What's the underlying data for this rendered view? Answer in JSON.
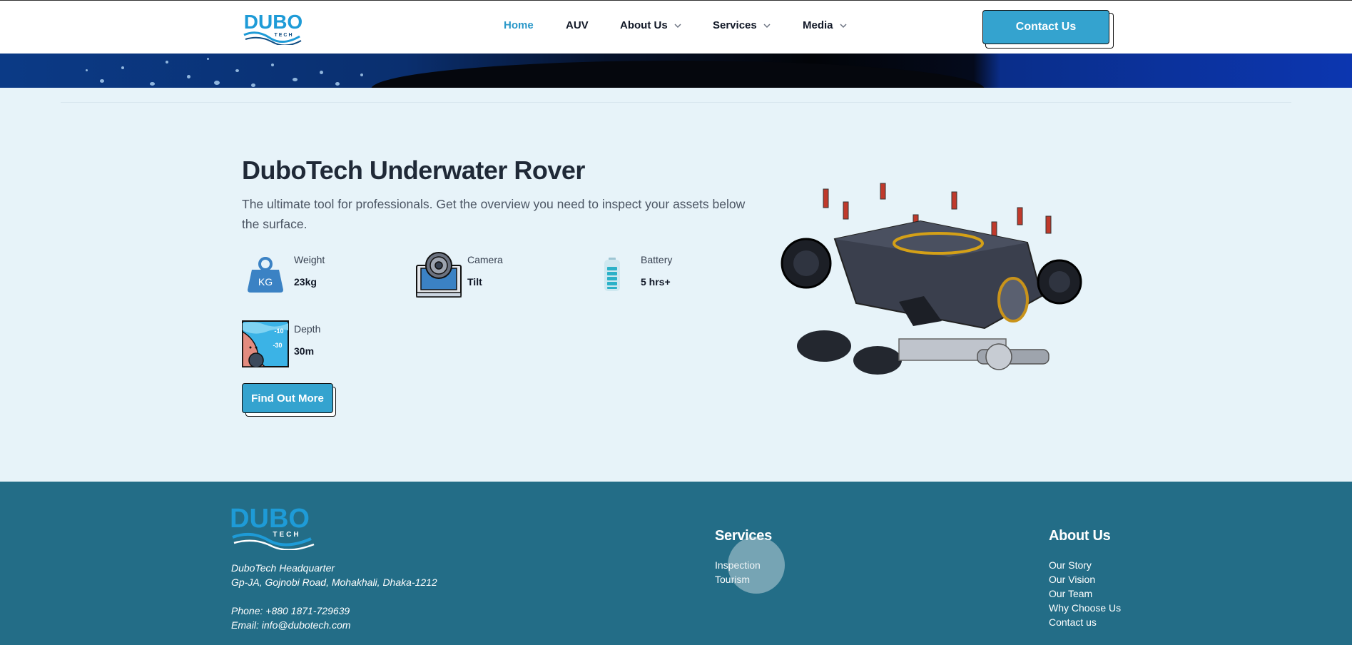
{
  "header": {
    "logo_text": "DUBO",
    "logo_sub": "TECH",
    "nav": [
      {
        "label": "Home",
        "active": true
      },
      {
        "label": "AUV"
      },
      {
        "label": "About Us",
        "dropdown": true
      },
      {
        "label": "Services",
        "dropdown": true
      },
      {
        "label": "Media",
        "dropdown": true
      }
    ],
    "contact_label": "Contact Us"
  },
  "product": {
    "title": "DuboTech Underwater Rover",
    "description": "The ultimate tool for professionals. Get the overview you need to inspect your assets below the surface.",
    "specs": [
      {
        "label": "Weight",
        "value": "23kg",
        "icon": "weight-icon"
      },
      {
        "label": "Camera",
        "value": "Tilt",
        "icon": "camera-icon"
      },
      {
        "label": "Battery",
        "value": "5 hrs+",
        "icon": "battery-icon"
      },
      {
        "label": "Depth",
        "value": "30m",
        "icon": "depth-icon"
      }
    ],
    "weight_icon_text": "KG",
    "depth_marks": [
      "-10",
      "-30"
    ],
    "cta_label": "Find Out More"
  },
  "footer": {
    "logo_text": "DUBO",
    "logo_sub": "TECH",
    "hq_name": "DuboTech Headquarter",
    "hq_address": "Gp-JA, Gojnobi Road, Mohakhali, Dhaka-1212",
    "phone": "Phone: +880 1871-729639",
    "email": "Email: info@dubotech.com",
    "services_title": "Services",
    "services_links": [
      "Inspection",
      "Tourism"
    ],
    "about_title": "About Us",
    "about_links": [
      "Our Story",
      "Our Vision",
      "Our Team",
      "Why Choose Us",
      "Contact us"
    ]
  },
  "colors": {
    "accent": "#34a3cf",
    "footer_bg": "#236d87",
    "section_bg": "#e7f3f9",
    "logo_blue": "#1e9bd7"
  }
}
